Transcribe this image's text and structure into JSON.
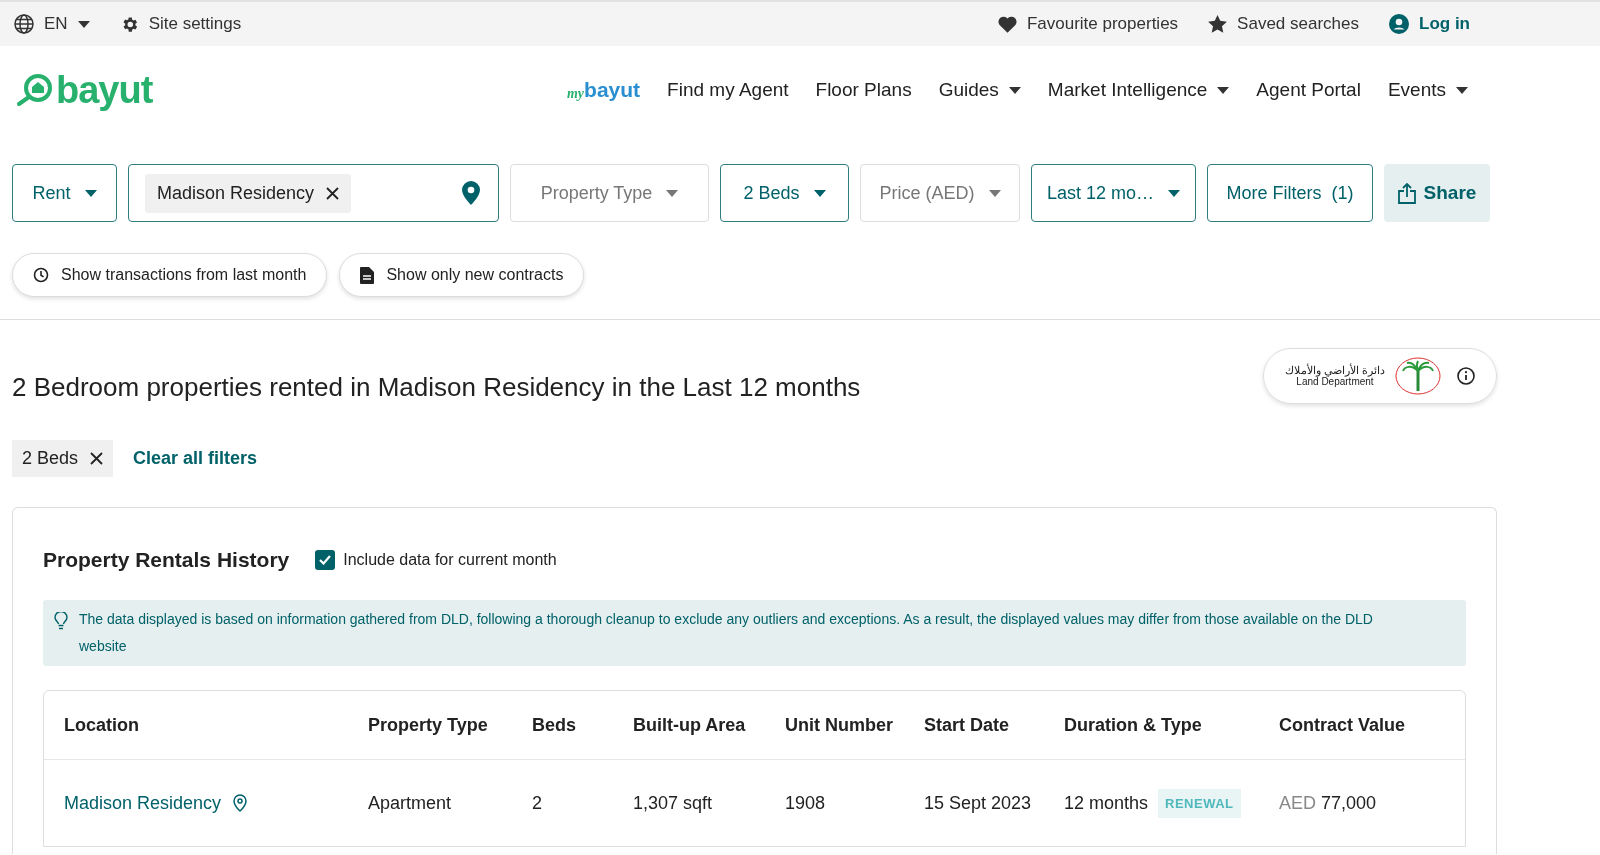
{
  "top_bar": {
    "language": "EN",
    "site_settings": "Site settings",
    "links": [
      {
        "label": "Favourite properties",
        "emphasis": false
      },
      {
        "label": "Saved searches",
        "emphasis": false
      },
      {
        "label": "Log in",
        "emphasis": true
      }
    ]
  },
  "header": {
    "logo": "bayut",
    "mybayut": {
      "prefix": "my",
      "name": "bayut"
    },
    "nav": [
      {
        "label": "Find my Agent",
        "dropdown": false
      },
      {
        "label": "Floor Plans",
        "dropdown": false
      },
      {
        "label": "Guides",
        "dropdown": true
      },
      {
        "label": "Market Intelligence",
        "dropdown": true
      },
      {
        "label": "Agent Portal",
        "dropdown": false
      },
      {
        "label": "Events",
        "dropdown": true
      }
    ]
  },
  "filters": [
    {
      "kind": "dropdown",
      "label": "Rent",
      "active": true
    },
    {
      "kind": "location",
      "value": "Madison Residency",
      "active": true
    },
    {
      "kind": "dropdown",
      "label": "Property Type",
      "active": false
    },
    {
      "kind": "dropdown",
      "label": "2 Beds",
      "active": true
    },
    {
      "kind": "dropdown",
      "label": "Price (AED)",
      "active": false
    },
    {
      "kind": "dropdown",
      "label": "Last 12 mo…",
      "active": true
    },
    {
      "kind": "button",
      "label": "More Filters",
      "count": "(1)",
      "active": true
    }
  ],
  "share": "Share",
  "quick_filters": [
    "Show transactions from last month",
    "Show only new contracts"
  ],
  "heading": "2 Bedroom properties rented in Madison Residency in the Last 12 months",
  "dld_badge": {
    "arabic": "دائرة الأراضي والأملاك",
    "english": "Land Department"
  },
  "applied_filters": [
    {
      "label": "2 Beds"
    }
  ],
  "clear_filters": "Clear all filters",
  "history": {
    "title": "Property Rentals History",
    "include_current": {
      "label": "Include data for current month",
      "checked": true
    },
    "notice": "The data displayed is based on information gathered from DLD, following a thorough cleanup to exclude any outliers and exceptions. As a result, the displayed values may differ from those available on the DLD website",
    "table": {
      "columns": [
        "Location",
        "Property Type",
        "Beds",
        "Built-up Area",
        "Unit Number",
        "Start Date",
        "Duration & Type",
        "Contract Value"
      ],
      "rows": [
        {
          "location": "Madison Residency",
          "property_type": "Apartment",
          "beds": "2",
          "area": "1,307 sqft",
          "unit": "1908",
          "start_date": "15 Sept 2023",
          "duration": "12 months",
          "contract_type": "RENEWAL",
          "currency": "AED",
          "value": "77,000"
        }
      ]
    }
  }
}
